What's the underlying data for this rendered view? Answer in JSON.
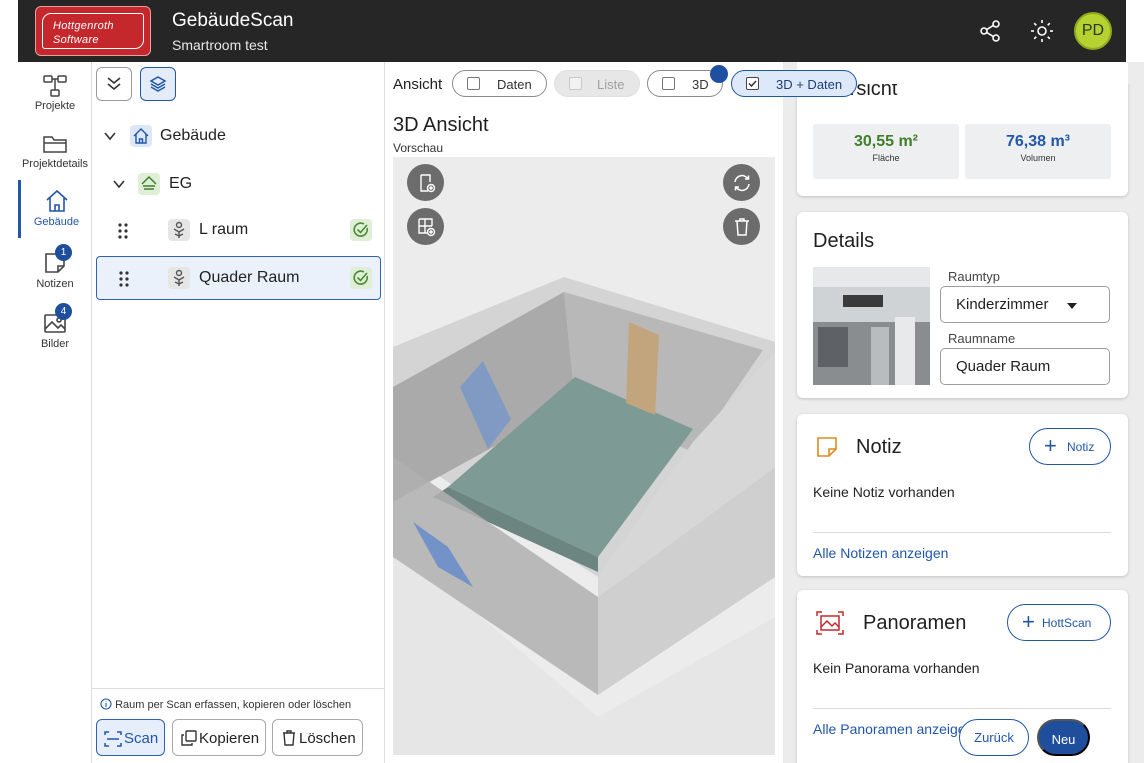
{
  "colors": {
    "accent": "#2256a8",
    "brand_red": "#c4282c",
    "topbar": "#262626",
    "avatar_bg": "#b5d132",
    "ok_green": "#4c8a34",
    "note_orange": "#e08a1e",
    "panorama_red": "#c4282c"
  },
  "header": {
    "logo_line1": "Hottgenroth",
    "logo_line2": "Software",
    "app_title": "GebäudeScan",
    "project_name": "Smartroom test",
    "icons": [
      "share-icon",
      "brightness-icon"
    ],
    "avatar_initials": "PD"
  },
  "nav": {
    "items": [
      {
        "label": "Projekte",
        "icon": "hierarchy-icon"
      },
      {
        "label": "Projektdetails",
        "icon": "folder-icon"
      },
      {
        "label": "Gebäude",
        "icon": "home-icon",
        "active": true
      },
      {
        "label": "Notizen",
        "icon": "note-icon",
        "badge": "1"
      },
      {
        "label": "Bilder",
        "icon": "image-icon",
        "badge": "4"
      }
    ]
  },
  "tree": {
    "toolbar_icons": [
      "collapse-all-icon",
      "layers-icon"
    ],
    "rows": [
      {
        "label": "Gebäude",
        "level": 0,
        "icon": "home-icon"
      },
      {
        "label": "EG",
        "level": 1,
        "icon": "floor-icon"
      },
      {
        "label": "L raum",
        "level": 2,
        "icon": "room-icon",
        "status_icon": "check-circle-icon"
      },
      {
        "label": "Quader Raum",
        "level": 2,
        "icon": "room-icon",
        "status_icon": "check-circle-icon",
        "selected": true
      }
    ],
    "hint": "Raum per Scan erfassen, kopieren oder löschen",
    "actions": {
      "scan": "Scan",
      "copy": "Kopieren",
      "delete": "Löschen"
    }
  },
  "view": {
    "ansicht_label": "Ansicht",
    "options": [
      {
        "label": "Daten",
        "checked": false,
        "enabled": true
      },
      {
        "label": "Liste",
        "checked": false,
        "enabled": false
      },
      {
        "label": "3D",
        "checked": false,
        "enabled": true
      },
      {
        "label": "3D + Daten",
        "checked": true,
        "enabled": true
      }
    ],
    "title": "3D Ansicht",
    "subtitle": "Vorschau",
    "tool_icons": [
      "add-door-icon",
      "add-window-icon",
      "refresh-icon",
      "trash-icon"
    ]
  },
  "overview": {
    "heading": "Übersicht",
    "area_value": "30,55 m²",
    "area_label": "Fläche",
    "volume_value": "76,38 m³",
    "volume_label": "Volumen"
  },
  "details": {
    "heading": "Details",
    "room_type_label": "Raumtyp",
    "room_type_value": "Kinderzimmer",
    "room_name_label": "Raumname",
    "room_name_value": "Quader Raum"
  },
  "notes": {
    "heading": "Notiz",
    "add_button": "Notiz",
    "empty_text": "Keine Notiz vorhanden",
    "show_all": "Alle Notizen anzeigen"
  },
  "panoramas": {
    "heading": "Panoramen",
    "add_button": "HottScan",
    "empty_text": "Kein Panorama vorhanden",
    "show_all": "Alle Panoramen anzeigen"
  },
  "footer": {
    "back": "Zurück",
    "new": "Neu"
  }
}
